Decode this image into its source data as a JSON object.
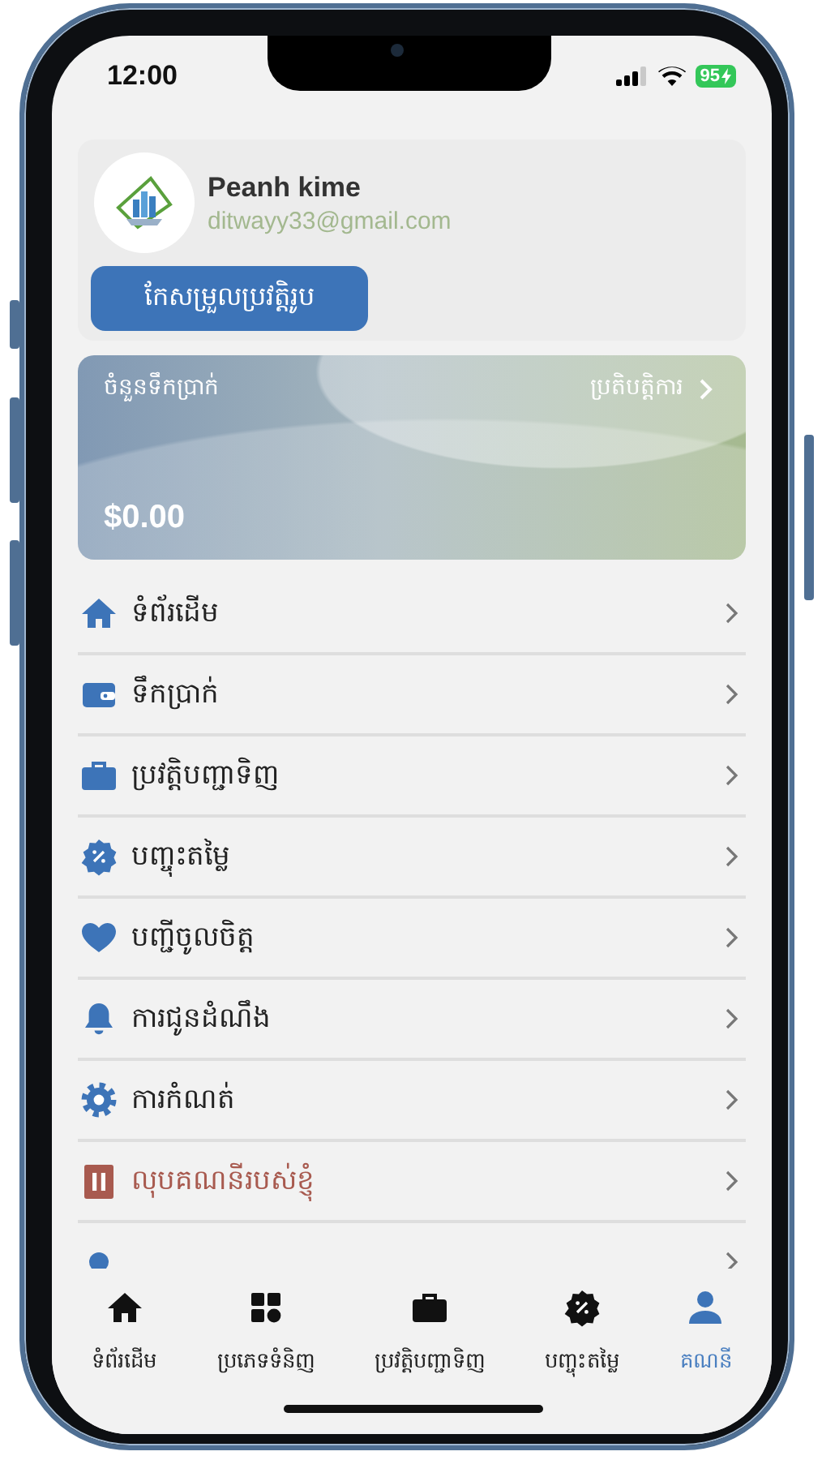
{
  "status_bar": {
    "time": "12:00",
    "battery": "95"
  },
  "profile": {
    "name": "Peanh kime",
    "email": "ditwayy33@gmail.com",
    "edit_button": "កែសម្រួលប្រវត្តិរូប"
  },
  "balance_card": {
    "label": "ចំនួនទឹកប្រាក់",
    "link": "ប្រតិបត្តិការ",
    "amount": "$0.00"
  },
  "menu": [
    {
      "label": "ទំព័រដើម",
      "kind": "home",
      "danger": false
    },
    {
      "label": "ទឹកប្រាក់",
      "kind": "wallet",
      "danger": false
    },
    {
      "label": "ប្រវត្តិបញ្ជាទិញ",
      "kind": "bag",
      "danger": false
    },
    {
      "label": "បញ្ចុះតម្លៃ",
      "kind": "discount",
      "danger": false
    },
    {
      "label": "បញ្ជីចូលចិត្ត",
      "kind": "heart",
      "danger": false
    },
    {
      "label": "ការជូនដំណឹង",
      "kind": "bell",
      "danger": false
    },
    {
      "label": "ការកំណត់",
      "kind": "gear",
      "danger": false
    },
    {
      "label": "លុបគណនីរបស់ខ្ញុំ",
      "kind": "trash",
      "danger": true
    },
    {
      "kind": "dot"
    }
  ],
  "tab_bar": [
    {
      "label": "ទំព័រដើម",
      "kind": "home",
      "selected": false
    },
    {
      "label": "ប្រភេទទំនិញ",
      "kind": "grid",
      "selected": false
    },
    {
      "label": "ប្រវត្តិបញ្ជាទិញ",
      "kind": "bag",
      "selected": false
    },
    {
      "label": "បញ្ចុះតម្លៃ",
      "kind": "discount",
      "selected": false
    },
    {
      "label": "គណនី",
      "kind": "user",
      "selected": true
    }
  ]
}
